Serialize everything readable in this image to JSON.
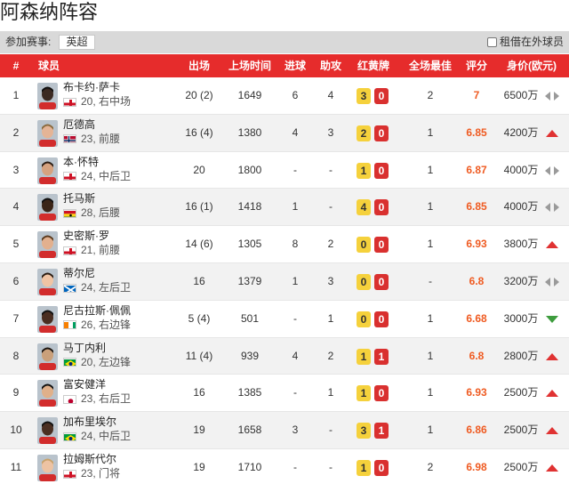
{
  "page": {
    "title": "阿森纳阵容"
  },
  "filter": {
    "label": "参加赛事:",
    "league": "英超",
    "loan_label": "租借在外球员"
  },
  "header": {
    "no": "#",
    "player": "球员",
    "apps": "出场",
    "minutes": "上场时间",
    "goals": "进球",
    "assists": "助攻",
    "cards": "红黄牌",
    "motm": "全场最佳",
    "rating": "评分",
    "value": "身价(欧元)"
  },
  "colors": {
    "header_bg": "#e62c2c",
    "yellow_card": "#f5d13c",
    "red_card": "#d9302f",
    "rating": "#ef5b22",
    "trend_up": "#e03232",
    "trend_down": "#3d9c3d",
    "trend_flat": "#9a9a9a"
  },
  "players": [
    {
      "no": "1",
      "name": "布卡约·萨卡",
      "age": "20",
      "position": "右中场",
      "flag": "england",
      "apps": "20 (2)",
      "minutes": "1649",
      "goals": "6",
      "assists": "4",
      "yellow": "3",
      "red": "0",
      "motm": "2",
      "rating": "7",
      "value": "6500万",
      "trend": "flat"
    },
    {
      "no": "2",
      "name": "厄德高",
      "age": "23",
      "position": "前腰",
      "flag": "norway",
      "apps": "16 (4)",
      "minutes": "1380",
      "goals": "4",
      "assists": "3",
      "yellow": "2",
      "red": "0",
      "motm": "1",
      "rating": "6.85",
      "value": "4200万",
      "trend": "up"
    },
    {
      "no": "3",
      "name": "本·怀特",
      "age": "24",
      "position": "中后卫",
      "flag": "england",
      "apps": "20",
      "minutes": "1800",
      "goals": "-",
      "assists": "-",
      "yellow": "1",
      "red": "0",
      "motm": "1",
      "rating": "6.87",
      "value": "4000万",
      "trend": "flat"
    },
    {
      "no": "4",
      "name": "托马斯",
      "age": "28",
      "position": "后腰",
      "flag": "ghana",
      "apps": "16 (1)",
      "minutes": "1418",
      "goals": "1",
      "assists": "-",
      "yellow": "4",
      "red": "0",
      "motm": "1",
      "rating": "6.85",
      "value": "4000万",
      "trend": "flat"
    },
    {
      "no": "5",
      "name": "史密斯·罗",
      "age": "21",
      "position": "前腰",
      "flag": "england",
      "apps": "14 (6)",
      "minutes": "1305",
      "goals": "8",
      "assists": "2",
      "yellow": "0",
      "red": "0",
      "motm": "1",
      "rating": "6.93",
      "value": "3800万",
      "trend": "up"
    },
    {
      "no": "6",
      "name": "蒂尔尼",
      "age": "24",
      "position": "左后卫",
      "flag": "scotland",
      "apps": "16",
      "minutes": "1379",
      "goals": "1",
      "assists": "3",
      "yellow": "0",
      "red": "0",
      "motm": "-",
      "rating": "6.8",
      "value": "3200万",
      "trend": "flat"
    },
    {
      "no": "7",
      "name": "尼古拉斯·佩佩",
      "age": "26",
      "position": "右边锋",
      "flag": "ivorycoast",
      "apps": "5 (4)",
      "minutes": "501",
      "goals": "-",
      "assists": "1",
      "yellow": "0",
      "red": "0",
      "motm": "1",
      "rating": "6.68",
      "value": "3000万",
      "trend": "down"
    },
    {
      "no": "8",
      "name": "马丁内利",
      "age": "20",
      "position": "左边锋",
      "flag": "brazil",
      "apps": "11 (4)",
      "minutes": "939",
      "goals": "4",
      "assists": "2",
      "yellow": "1",
      "red": "1",
      "motm": "1",
      "rating": "6.8",
      "value": "2800万",
      "trend": "up"
    },
    {
      "no": "9",
      "name": "富安健洋",
      "age": "23",
      "position": "右后卫",
      "flag": "japan",
      "apps": "16",
      "minutes": "1385",
      "goals": "-",
      "assists": "1",
      "yellow": "1",
      "red": "0",
      "motm": "1",
      "rating": "6.93",
      "value": "2500万",
      "trend": "up"
    },
    {
      "no": "10",
      "name": "加布里埃尔",
      "age": "24",
      "position": "中后卫",
      "flag": "brazil",
      "apps": "19",
      "minutes": "1658",
      "goals": "3",
      "assists": "-",
      "yellow": "3",
      "red": "1",
      "motm": "1",
      "rating": "6.86",
      "value": "2500万",
      "trend": "up"
    },
    {
      "no": "11",
      "name": "拉姆斯代尔",
      "age": "23",
      "position": "门将",
      "flag": "england",
      "apps": "19",
      "minutes": "1710",
      "goals": "-",
      "assists": "-",
      "yellow": "1",
      "red": "0",
      "motm": "2",
      "rating": "6.98",
      "value": "2500万",
      "trend": "up"
    }
  ]
}
